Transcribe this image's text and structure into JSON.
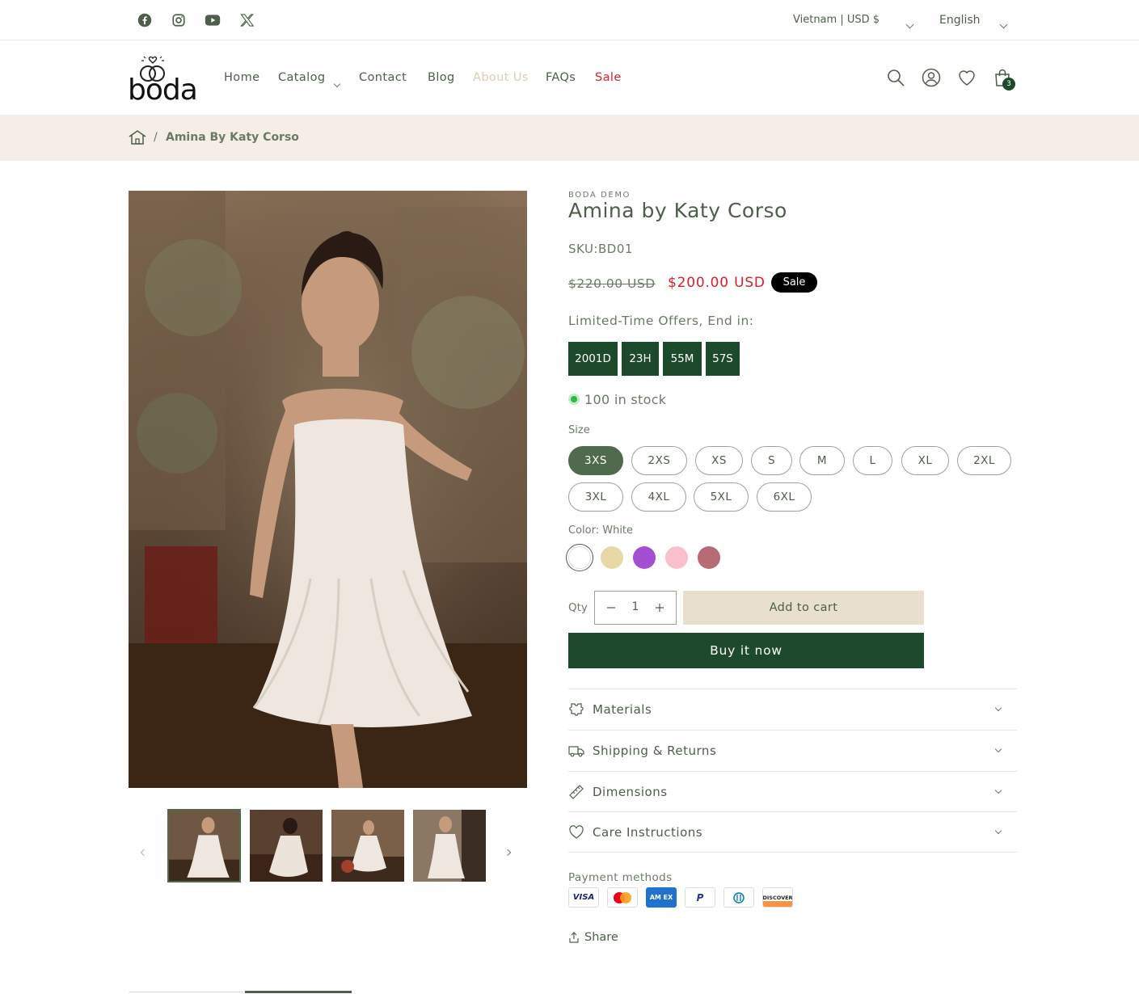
{
  "topbar": {
    "social": [
      "facebook-icon",
      "instagram-icon",
      "youtube-icon",
      "x-icon"
    ],
    "country_currency": "Vietnam | USD $",
    "language": "English"
  },
  "header": {
    "logo_text": "boda",
    "nav": {
      "home": "Home",
      "catalog": "Catalog",
      "contact": "Contact",
      "blog": "Blog",
      "about": "About Us",
      "faqs": "FAQs",
      "sale": "Sale"
    },
    "cart_count": "3"
  },
  "breadcrumb": {
    "separator": "/",
    "current": "Amina By Katy Corso"
  },
  "product": {
    "vendor": "BODA DEMO",
    "title": "Amina by Katy Corso",
    "sku": "SKU:BD01",
    "compare_price": "$220.00 USD",
    "price": "$200.00 USD",
    "sale_badge": "Sale",
    "countdown_label": "Limited-Time Offers, End in:",
    "countdown": {
      "days": "2001D",
      "hours": "23H",
      "minutes": "55M",
      "seconds": "57S"
    },
    "stock": "100 in stock",
    "size_label": "Size",
    "sizes": [
      "3XS",
      "2XS",
      "XS",
      "S",
      "M",
      "L",
      "XL",
      "2XL",
      "3XL",
      "4XL",
      "5XL",
      "6XL"
    ],
    "selected_size": "3XS",
    "color_label": "Color: White",
    "colors": [
      "#ffffff",
      "#e8d8a8",
      "#a24fd1",
      "#f8c0cc",
      "#b86a75"
    ],
    "qty_label": "Qty",
    "qty_value": "1",
    "add_to_cart": "Add to cart",
    "buy_now": "Buy it now",
    "accordions": {
      "materials": "Materials",
      "shipping": "Shipping & Returns",
      "dimensions": "Dimensions",
      "care": "Care Instructions"
    },
    "payment_label": "Payment methods",
    "payment_methods": [
      "visa-icon",
      "mastercard-icon",
      "amex-icon",
      "paypal-icon",
      "diners-icon",
      "discover-icon"
    ],
    "payment_text": {
      "visa": "VISA",
      "amex": "AM EX",
      "paypal": "P",
      "discover": "DISCOVER"
    },
    "share": "Share"
  },
  "colors": {
    "brand_green": "#1d4a2c",
    "text": "#4d5e4a",
    "sale_red": "#d6202a",
    "breadcrumb_bg": "#f4eee6",
    "cart_button_bg": "#e8dfcc"
  }
}
